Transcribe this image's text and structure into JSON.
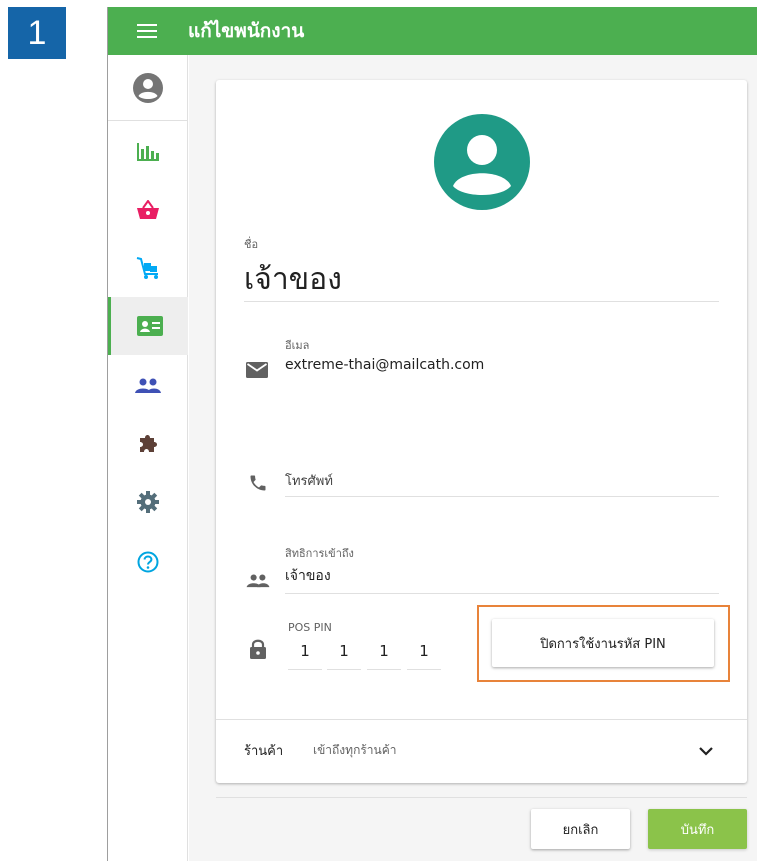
{
  "step_badge": "1",
  "header": {
    "title": "แก้ไขพนักงาน",
    "menu_icon": "hamburger-menu-icon"
  },
  "sidebar": {
    "items": [
      {
        "icon": "account-circle-icon",
        "color": "#757575"
      },
      {
        "icon": "bar-chart-icon",
        "color": "#4caf50"
      },
      {
        "icon": "shopping-basket-icon",
        "color": "#e91e63"
      },
      {
        "icon": "inventory-cart-icon",
        "color": "#03a9f4"
      },
      {
        "icon": "employee-badge-icon",
        "color": "#4caf50",
        "active": true
      },
      {
        "icon": "customers-group-icon",
        "color": "#3f51b5"
      },
      {
        "icon": "integrations-puzzle-icon",
        "color": "#5d4037"
      },
      {
        "icon": "settings-gear-icon",
        "color": "#546e7a"
      },
      {
        "icon": "help-circle-icon",
        "color": "#00a5e0"
      }
    ]
  },
  "form": {
    "name_label": "ชื่อ",
    "name_value": "เจ้าของ",
    "email_label": "อีเมล",
    "email_value": "extreme-thai@mailcath.com",
    "phone_placeholder": "โทรศัพท์",
    "role_label": "สิทธิการเข้าถึง",
    "role_value": "เจ้าของ",
    "pin_label": "POS PIN",
    "pin_digits": [
      "1",
      "1",
      "1",
      "1"
    ],
    "disable_pin_button": "ปิดการใช้งานรหัส PIN",
    "store_label": "ร้านค้า",
    "store_value": "เข้าถึงทุกร้านค้า"
  },
  "footer": {
    "cancel_label": "ยกเลิก",
    "save_label": "บันทึก"
  },
  "colors": {
    "header_green": "#4caf50",
    "avatar_teal": "#1f9a86",
    "save_green": "#8bc34a",
    "highlight_orange": "#e8833a",
    "step_badge_blue": "#1565a8"
  }
}
